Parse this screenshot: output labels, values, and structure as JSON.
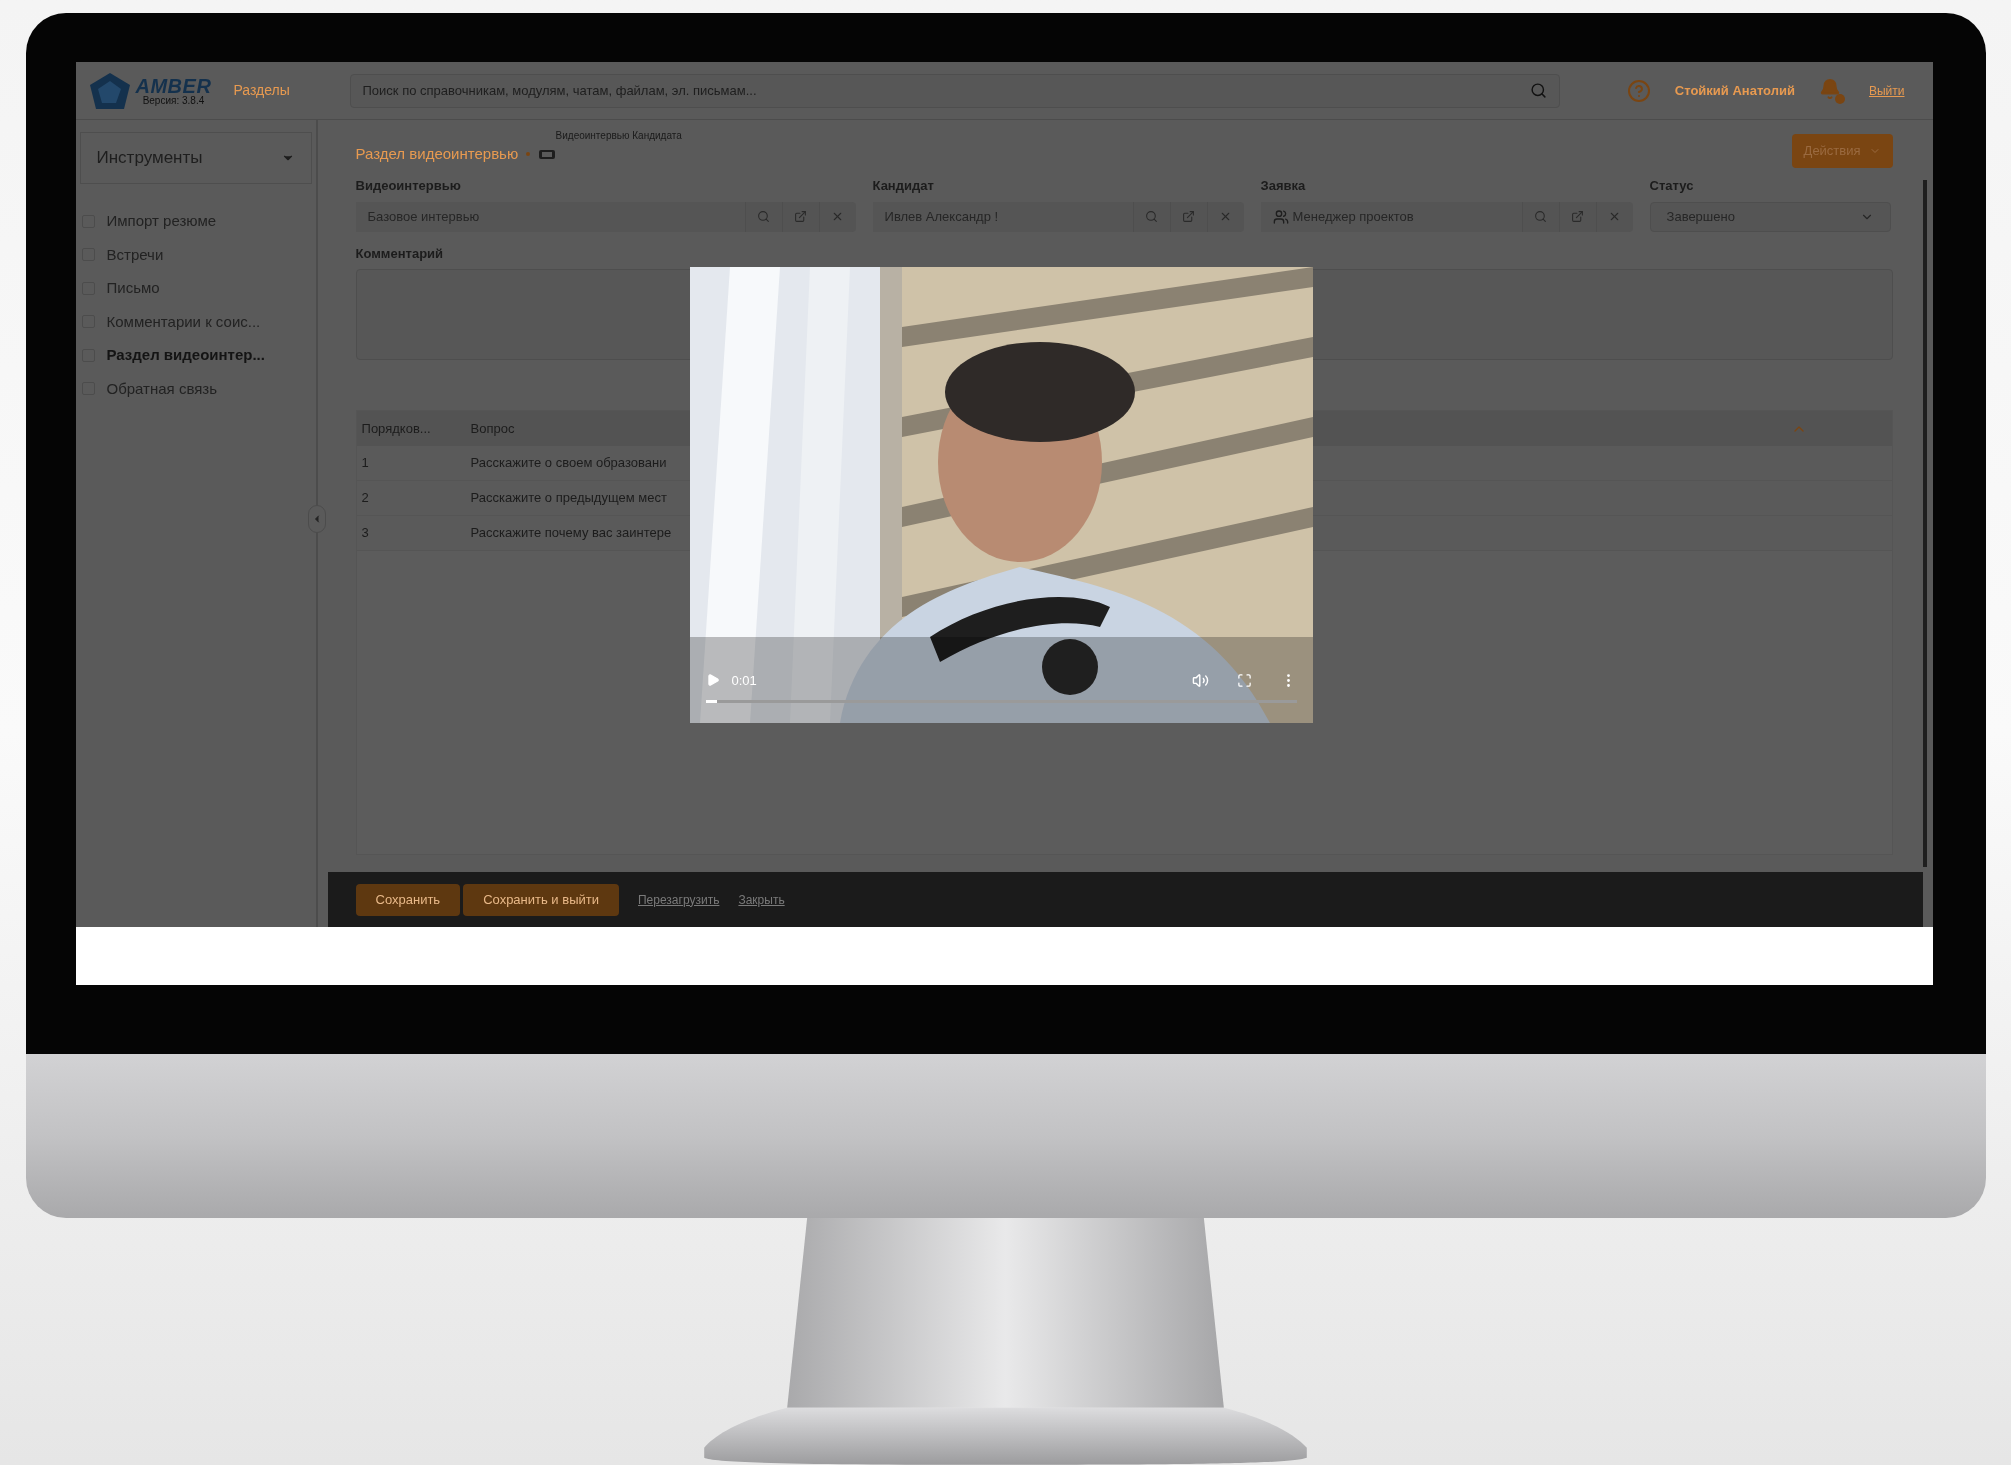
{
  "header": {
    "logo": "AMBER",
    "version": "Версия: 3.8.4",
    "sections_link": "Разделы",
    "search": {
      "placeholder": "Поиск по справочникам, модулям, чатам, файлам, эл. письмам..."
    },
    "user": "Стойкий Анатолий",
    "logout": "Выйти"
  },
  "sidebar": {
    "dropdown": "Инструменты",
    "items": [
      {
        "label": "Импорт резюме",
        "selected": false
      },
      {
        "label": "Встречи",
        "selected": false
      },
      {
        "label": "Письмо",
        "selected": false
      },
      {
        "label": "Комментарии к соис...",
        "selected": false
      },
      {
        "label": "Раздел видеоинтер...",
        "selected": true
      },
      {
        "label": "Обратная связь",
        "selected": false
      }
    ]
  },
  "breadcrumb": {
    "title": "Раздел видеоинтервью",
    "subtitle": "Видеоинтервью Кандидата"
  },
  "actions_button": "Действия",
  "fields": [
    {
      "label": "Видеоинтервью",
      "value": "Базовое интервью",
      "kind": "lookup"
    },
    {
      "label": "Кандидат",
      "value": "Ивлев Александр !",
      "kind": "lookup"
    },
    {
      "label": "Заявка",
      "value": "Менеджер проектов",
      "kind": "request"
    },
    {
      "label": "Статус",
      "value": "Завершено",
      "kind": "select"
    }
  ],
  "comment": {
    "label": "Комментарий"
  },
  "table": {
    "columns": [
      "Порядков...",
      "Вопрос"
    ],
    "rows": [
      [
        "1",
        "Расскажите о своем образовани"
      ],
      [
        "2",
        "Расскажите о предыдущем мест"
      ],
      [
        "3",
        "Расскажите почему вас заинтере"
      ]
    ]
  },
  "footer": {
    "buttons": [
      "Сохранить",
      "Сохранить и выйти"
    ],
    "links": [
      "Перезагрузить",
      "Закрыть"
    ]
  },
  "video": {
    "time": "0:01",
    "progress": {
      "level": 0.02
    }
  }
}
